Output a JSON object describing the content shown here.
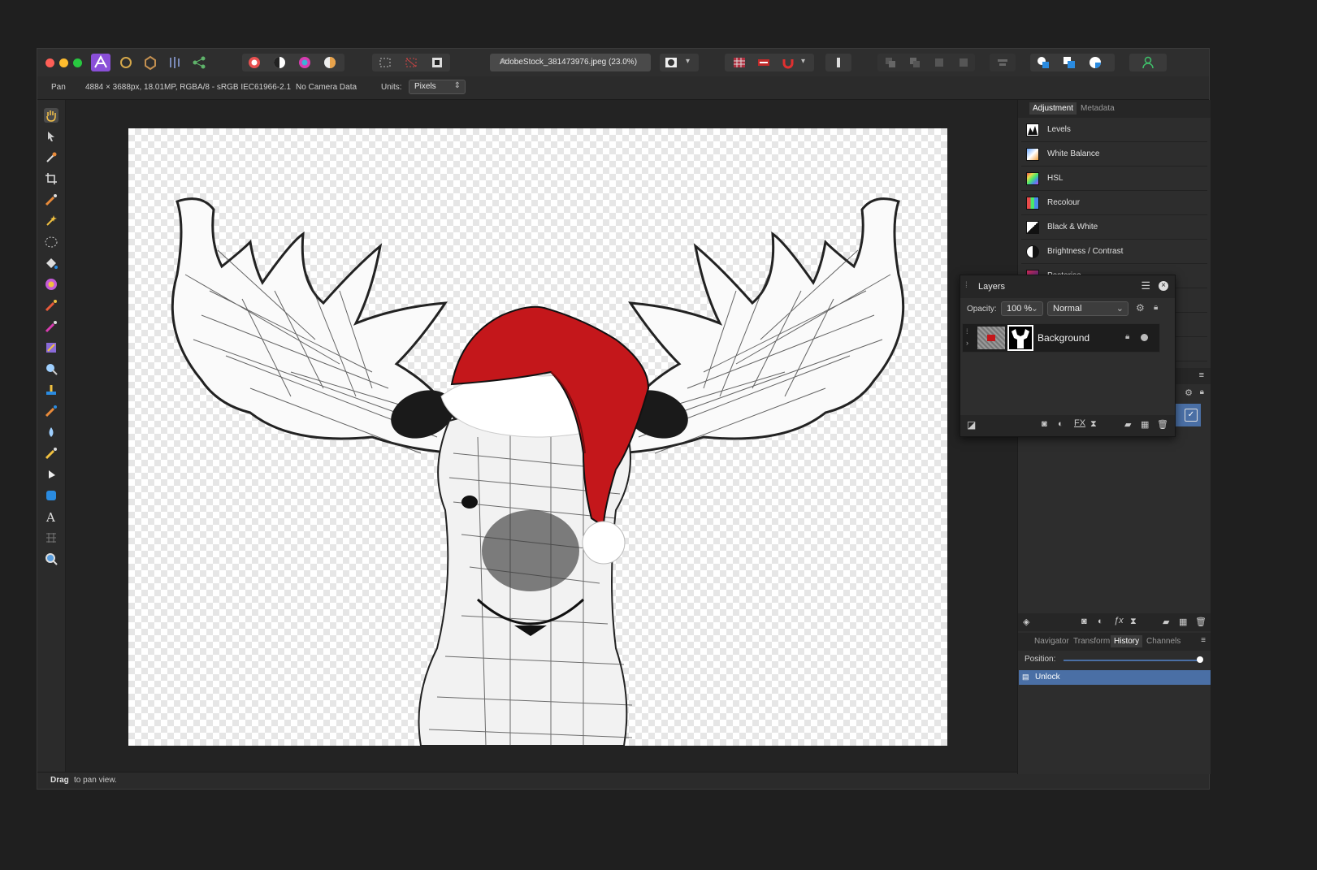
{
  "document": {
    "tab_title": "AdobeStock_381473976.jpeg (23.0%)",
    "tab_modified_mark": "★"
  },
  "context_bar": {
    "tool": "Pan",
    "image_info": "4884 × 3688px, 18.01MP, RGBA/8 - sRGB IEC61966-2.1",
    "camera": "No Camera Data",
    "units_label": "Units:",
    "units_value": "Pixels"
  },
  "status": {
    "bold": "Drag",
    "text": "to pan view."
  },
  "right_panel": {
    "tabs": [
      {
        "label": "Adjustment",
        "active": true
      },
      {
        "label": "Metadata",
        "active": false
      }
    ],
    "adjustments": [
      {
        "label": "Levels",
        "icon": "levels-icon"
      },
      {
        "label": "White Balance",
        "icon": "white-balance-icon"
      },
      {
        "label": "HSL",
        "icon": "hsl-icon"
      },
      {
        "label": "Recolour",
        "icon": "recolour-icon"
      },
      {
        "label": "Black & White",
        "icon": "black-white-icon"
      },
      {
        "label": "Brightness / Contrast",
        "icon": "brightness-contrast-icon"
      },
      {
        "label": "Posterise",
        "icon": "posterise-icon"
      }
    ],
    "bottom_tabs": [
      {
        "label": "Navigator",
        "active": false
      },
      {
        "label": "Transform",
        "active": false
      },
      {
        "label": "History",
        "active": true
      },
      {
        "label": "Channels",
        "active": false
      }
    ],
    "position_label": "Position:",
    "history_position": 1.0,
    "history_items": [
      "Unlock"
    ]
  },
  "layers_panel": {
    "title": "Layers",
    "opacity_label": "Opacity:",
    "opacity_value": "100 %",
    "blend_mode": "Normal",
    "layers": [
      {
        "name": "Background",
        "locked": true,
        "visible": true
      }
    ]
  },
  "colors": {
    "accent": "#4a6fa5",
    "hat_red": "#c4171b"
  }
}
